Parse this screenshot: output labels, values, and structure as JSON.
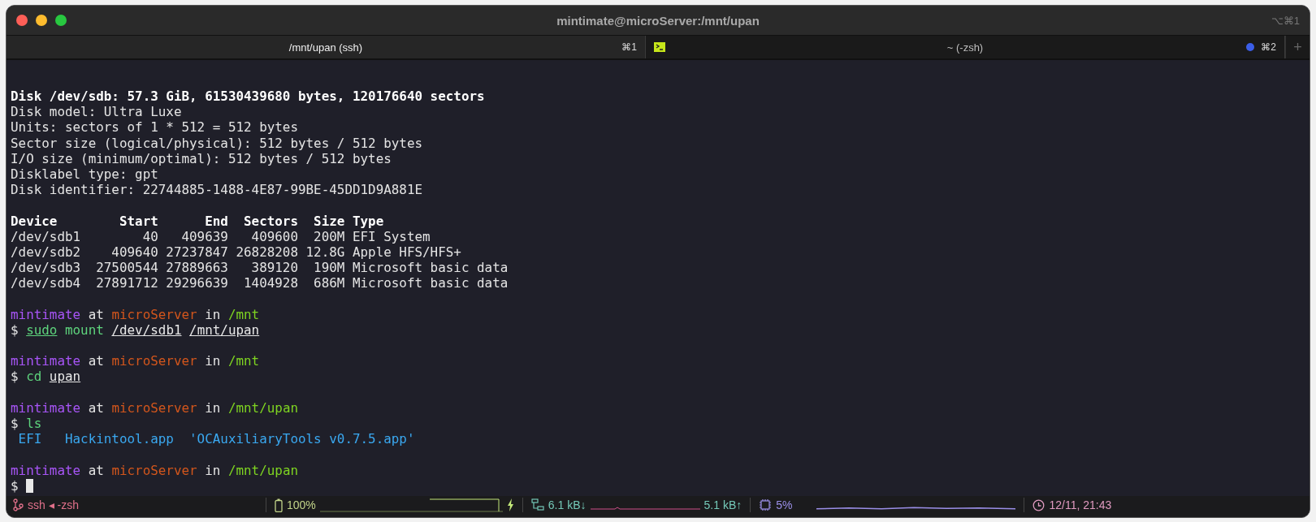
{
  "window": {
    "title": "mintimate@microServer:/mnt/upan",
    "shortcut": "⌥⌘1"
  },
  "tabs": [
    {
      "label": "/mnt/upan (ssh)",
      "shortcut": "⌘1",
      "selected": true,
      "activity": false,
      "icon": false
    },
    {
      "label": "~ (-zsh)",
      "shortcut": "⌘2",
      "selected": false,
      "activity": true,
      "icon": true
    }
  ],
  "new_tab_button": "+",
  "terminal": {
    "blocks": [
      {
        "lines": [
          {
            "segments": [
              {
                "text": "Disk /dev/sdb: 57.3 GiB, 61530439680 bytes, 120176640 sectors",
                "kind": "bold"
              }
            ]
          },
          {
            "segments": [
              {
                "text": "Disk model: Ultra Luxe",
                "kind": "plain"
              }
            ]
          },
          {
            "segments": [
              {
                "text": "Units: sectors of 1 * 512 = 512 bytes",
                "kind": "plain"
              }
            ]
          },
          {
            "segments": [
              {
                "text": "Sector size (logical/physical): 512 bytes / 512 bytes",
                "kind": "plain"
              }
            ]
          },
          {
            "segments": [
              {
                "text": "I/O size (minimum/optimal): 512 bytes / 512 bytes",
                "kind": "plain"
              }
            ]
          },
          {
            "segments": [
              {
                "text": "Disklabel type: gpt",
                "kind": "plain"
              }
            ]
          },
          {
            "segments": [
              {
                "text": "Disk identifier: 22744885-1488-4E87-99BE-45DD1D9A881E",
                "kind": "plain"
              }
            ]
          }
        ]
      },
      {
        "lines": [
          {
            "segments": [
              {
                "text": "Device        Start      End  Sectors  Size Type",
                "kind": "bold"
              }
            ]
          },
          {
            "segments": [
              {
                "text": "/dev/sdb1        40   409639   409600  200M EFI System",
                "kind": "plain"
              }
            ]
          },
          {
            "segments": [
              {
                "text": "/dev/sdb2    409640 27237847 26828208 12.8G Apple HFS/HFS+",
                "kind": "plain"
              }
            ]
          },
          {
            "segments": [
              {
                "text": "/dev/sdb3  27500544 27889663   389120  190M Microsoft basic data",
                "kind": "plain"
              }
            ]
          },
          {
            "segments": [
              {
                "text": "/dev/sdb4  27891712 29296639  1404928  686M Microsoft basic data",
                "kind": "plain"
              }
            ]
          }
        ]
      },
      {
        "lines": [
          {
            "segments": [
              {
                "text": "mintimate",
                "kind": "user"
              },
              {
                "text": " at ",
                "kind": "plain"
              },
              {
                "text": "microServer",
                "kind": "host"
              },
              {
                "text": " in ",
                "kind": "plain"
              },
              {
                "text": "/mnt",
                "kind": "path"
              }
            ]
          },
          {
            "segments": [
              {
                "text": "$ ",
                "kind": "plain"
              },
              {
                "text": "sudo",
                "kind": "cmd_link"
              },
              {
                "text": " mount ",
                "kind": "cmd"
              },
              {
                "text": "/dev/sdb1",
                "kind": "arg"
              },
              {
                "text": "/mnt/upan",
                "kind": "arg_spaced"
              }
            ]
          }
        ]
      },
      {
        "lines": [
          {
            "segments": [
              {
                "text": "mintimate",
                "kind": "user"
              },
              {
                "text": " at ",
                "kind": "plain"
              },
              {
                "text": "microServer",
                "kind": "host"
              },
              {
                "text": " in ",
                "kind": "plain"
              },
              {
                "text": "/mnt",
                "kind": "path"
              }
            ]
          },
          {
            "segments": [
              {
                "text": "$ ",
                "kind": "plain"
              },
              {
                "text": "cd ",
                "kind": "cmd"
              },
              {
                "text": "upan",
                "kind": "arg"
              }
            ]
          }
        ]
      },
      {
        "lines": [
          {
            "segments": [
              {
                "text": "mintimate",
                "kind": "user"
              },
              {
                "text": " at ",
                "kind": "plain"
              },
              {
                "text": "microServer",
                "kind": "host"
              },
              {
                "text": " in ",
                "kind": "plain"
              },
              {
                "text": "/mnt/upan",
                "kind": "path"
              }
            ]
          },
          {
            "segments": [
              {
                "text": "$ ",
                "kind": "plain"
              },
              {
                "text": "ls",
                "kind": "cmd"
              }
            ]
          },
          {
            "segments": [
              {
                "text": " EFI   Hackintool.app  'OCAuxiliaryTools v0.7.5.app'",
                "kind": "file"
              }
            ]
          }
        ]
      },
      {
        "lines": [
          {
            "segments": [
              {
                "text": "mintimate",
                "kind": "user"
              },
              {
                "text": " at ",
                "kind": "plain"
              },
              {
                "text": "microServer",
                "kind": "host"
              },
              {
                "text": " in ",
                "kind": "plain"
              },
              {
                "text": "/mnt/upan",
                "kind": "path"
              }
            ]
          },
          {
            "segments": [
              {
                "text": "$ ",
                "kind": "plain"
              }
            ],
            "cursor": true
          }
        ]
      }
    ]
  },
  "status_bar": {
    "session": "ssh ◂ -zsh",
    "battery": "100%",
    "download": "6.1 kB↓",
    "upload": "5.1 kB↑",
    "cpu": "5%",
    "clock": "12/11, 21:43"
  }
}
